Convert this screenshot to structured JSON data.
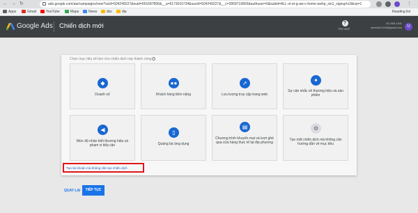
{
  "browser": {
    "url": "ads.google.com/aw/campaigns/new?ocid=504249227&euid=651687896&__u=6173016734&uscid=504249227&__c=2869716803&authuser=0&subid=ALL-vi-et-g-aw-c-home-awhp_xin1_signup!o2&ivp=1",
    "bookmarks": [
      "Apps",
      "Gmail",
      "YouTube",
      "Maps",
      "News",
      "đọc",
      "địa"
    ],
    "reading_list": "Reading list"
  },
  "header": {
    "product": "Google Ads",
    "page_title": "Chiến dịch mới",
    "help_label": "TRỢ GIÚP",
    "account_id": "211-509-1441",
    "account_email": "usercheu1249@gmail.com",
    "avatar_letter": "U"
  },
  "card": {
    "prompt": "Chọn mục tiêu sẽ làm cho chiến dịch này thành công",
    "info_icon": "?",
    "tiles": [
      {
        "label": "Doanh số",
        "icon": "tag-icon",
        "glyph": "◆"
      },
      {
        "label": "Khách hàng tiềm năng",
        "icon": "people-icon",
        "glyph": "●●"
      },
      {
        "label": "Lưu lượng truy cập trang web",
        "icon": "cursor-icon",
        "glyph": "➚"
      },
      {
        "label": "Sự cân nhắc về thương hiệu và sản phẩm",
        "icon": "sparkle-icon",
        "glyph": "✦"
      },
      {
        "label": "Mức độ nhận biết thương hiệu và phạm vi tiếp cận",
        "icon": "speaker-icon",
        "glyph": "◀"
      },
      {
        "label": "Quảng bá ứng dụng",
        "icon": "phone-icon",
        "glyph": "▯"
      },
      {
        "label": "Chương trình khuyến mại và lượt ghé qua cửa hàng thực tế tại địa phương",
        "icon": "store-icon",
        "glyph": "▤"
      },
      {
        "label": "Tạo một chiến dịch mà không cần hướng dẫn về mục tiêu",
        "icon": "gear-icon",
        "glyph": "⚙"
      }
    ],
    "skip_link": "Tạo tài khoản mà không cần tạo chiến dịch"
  },
  "footer": {
    "back": "QUAY LẠI",
    "continue": "TIẾP TỤC"
  },
  "colors": {
    "accent": "#1a73e8",
    "header_bg": "#3c4043",
    "highlight_border": "#e0151a"
  }
}
